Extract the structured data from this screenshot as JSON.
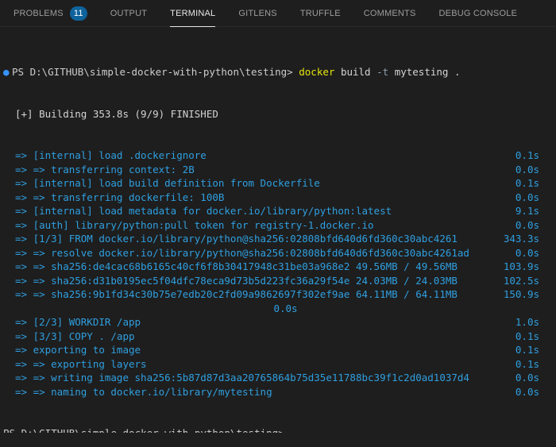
{
  "tabs": [
    {
      "label": "PROBLEMS",
      "badge": "11",
      "active": false
    },
    {
      "label": "OUTPUT",
      "active": false
    },
    {
      "label": "TERMINAL",
      "active": true
    },
    {
      "label": "GITLENS",
      "active": false
    },
    {
      "label": "TRUFFLE",
      "active": false
    },
    {
      "label": "COMMENTS",
      "active": false
    },
    {
      "label": "DEBUG CONSOLE",
      "active": false
    }
  ],
  "terminal": {
    "prompt": "PS D:\\GITHUB\\simple-docker-with-python\\testing>",
    "cmd": "docker",
    "cmd_rest": "build",
    "flag": "-t",
    "arg": "mytesting .",
    "building": "[+] Building 353.8s (9/9) FINISHED",
    "lines": [
      {
        "text": "=> [internal] load .dockerignore",
        "time": "0.1s"
      },
      {
        "text": "=> => transferring context: 2B",
        "time": "0.0s"
      },
      {
        "text": "=> [internal] load build definition from Dockerfile",
        "time": "0.1s"
      },
      {
        "text": "=> => transferring dockerfile: 100B",
        "time": "0.0s"
      },
      {
        "text": "=> [internal] load metadata for docker.io/library/python:latest",
        "time": "9.1s"
      },
      {
        "text": "=> [auth] library/python:pull token for registry-1.docker.io",
        "time": "0.0s"
      },
      {
        "text": "=> [1/3] FROM docker.io/library/python@sha256:02808bfd640d6fd360c30abc4261",
        "time": "343.3s"
      },
      {
        "text": "=> => resolve docker.io/library/python@sha256:02808bfd640d6fd360c30abc4261ad",
        "time": "0.0s"
      },
      {
        "text": "=> => sha256:de4cac68b6165c40cf6f8b30417948c31be03a968e2 49.56MB / 49.56MB",
        "time": "103.9s"
      },
      {
        "text": "=> => sha256:d31b0195ec5f04dfc78eca9d73b5d223fc36a29f54e 24.03MB / 24.03MB",
        "time": "102.5s"
      },
      {
        "text": "=> => sha256:9b1fd34c30b75e7edb20c2fd09a9862697f302ef9ae 64.11MB / 64.11MB",
        "time": "150.9s"
      },
      {
        "text": "",
        "time": "0.0s",
        "wrapped": true
      },
      {
        "text": "=> [2/3] WORKDIR /app",
        "time": "1.0s"
      },
      {
        "text": "=> [3/3] COPY . /app",
        "time": "0.1s"
      },
      {
        "text": "=> exporting to image",
        "time": "0.1s"
      },
      {
        "text": "=> => exporting layers",
        "time": "0.1s"
      },
      {
        "text": "=> => writing image sha256:5b87d87d3aa20765864b75d35e11788bc39f1c2d0ad1037d4",
        "time": "0.0s"
      },
      {
        "text": "=> => naming to docker.io/library/mytesting",
        "time": "0.0s"
      }
    ],
    "cutoff_line": "PS D:\\GITHUB\\simple-docker-with-python\\testing>"
  }
}
